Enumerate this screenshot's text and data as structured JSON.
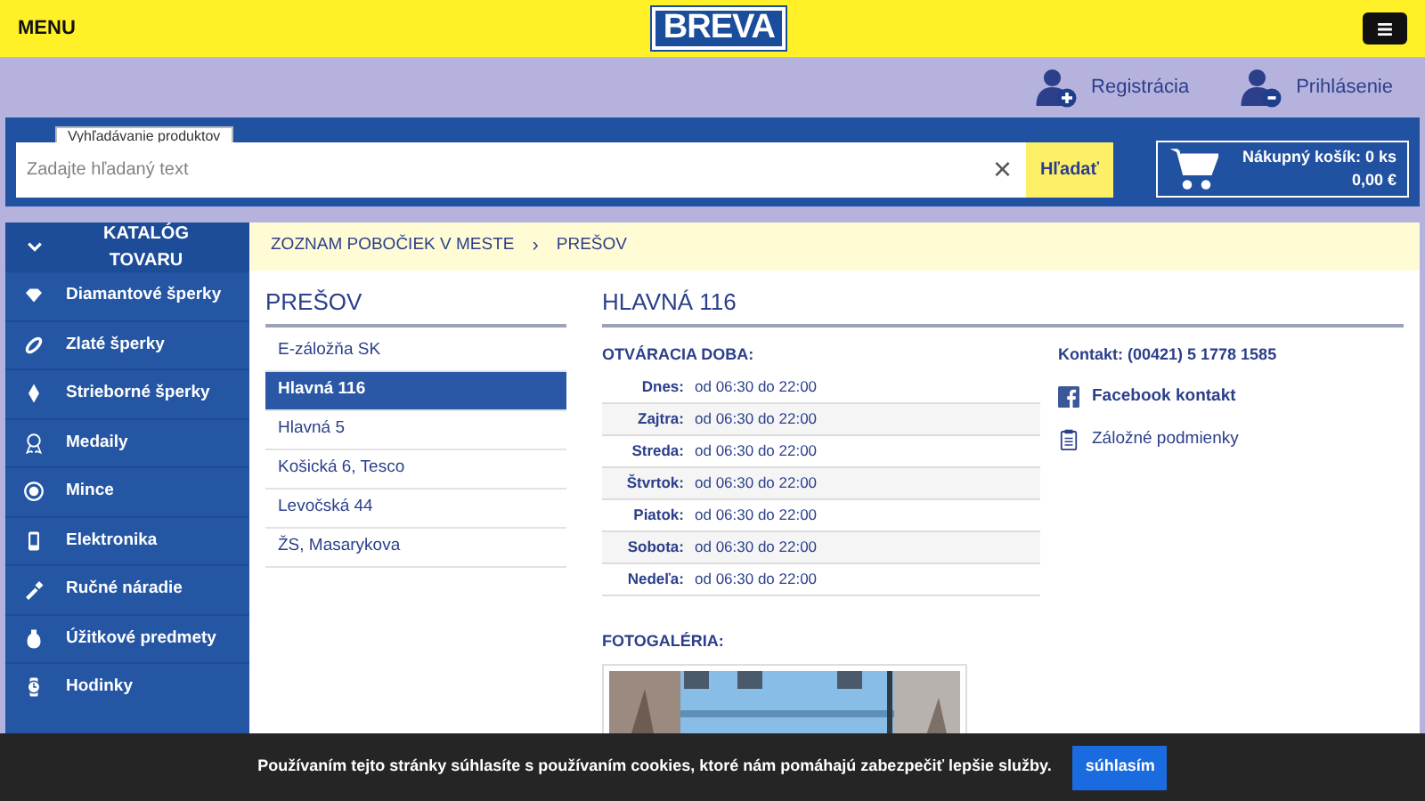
{
  "header": {
    "menu_label": "MENU",
    "logo": "BREVA"
  },
  "account": [
    {
      "label": "Registrácia",
      "kind": "register"
    },
    {
      "label": "Prihlásenie",
      "kind": "login"
    }
  ],
  "search": {
    "legend": "Vyhľadávanie produktov",
    "placeholder": "Zadajte hľadaný text",
    "clear": "×",
    "button": "Hľadať"
  },
  "cart": {
    "title": "Nákupný košík: 0 ks",
    "total": "0,00 €"
  },
  "sidebar": {
    "title": "KATALÓG TOVARU",
    "expanded": true,
    "items": [
      {
        "label": "Diamantové šperky",
        "kind": "diamond"
      },
      {
        "label": "Zlaté šperky",
        "kind": "ring"
      },
      {
        "label": "Strieborné šperky",
        "kind": "gem"
      },
      {
        "label": "Medaily",
        "kind": "medal"
      },
      {
        "label": "Mince",
        "kind": "coin"
      },
      {
        "label": "Elektronika",
        "kind": "phone"
      },
      {
        "label": "Ručné náradie",
        "kind": "tool"
      },
      {
        "label": "Úžitkové predmety",
        "kind": "vase"
      },
      {
        "label": "Hodinky",
        "kind": "watch"
      }
    ]
  },
  "breadcrumb": [
    "ZOZNAM POBOČIEK V MESTE",
    "PREŠOV"
  ],
  "breadcrumb_separator": "›",
  "city": {
    "title": "PREŠOV",
    "branches": [
      {
        "label": "E-záložňa SK",
        "selected": false
      },
      {
        "label": "Hlavná 116",
        "selected": true
      },
      {
        "label": "Hlavná 5",
        "selected": false
      },
      {
        "label": "Košická 6, Tesco",
        "selected": false
      },
      {
        "label": "Levočská 44",
        "selected": false
      },
      {
        "label": "ŽS, Masarykova",
        "selected": false
      }
    ]
  },
  "branch": {
    "title": "HLAVNÁ 116",
    "hours_title": "OTVÁRACIA DOBA:",
    "hours": [
      {
        "day": "Dnes:",
        "time": "od 06:30 do 22:00"
      },
      {
        "day": "Zajtra:",
        "time": "od 06:30 do 22:00"
      },
      {
        "day": "Streda:",
        "time": "od 06:30 do 22:00"
      },
      {
        "day": "Štvrtok:",
        "time": "od 06:30 do 22:00"
      },
      {
        "day": "Piatok:",
        "time": "od 06:30 do 22:00"
      },
      {
        "day": "Sobota:",
        "time": "od 06:30 do 22:00"
      },
      {
        "day": "Nedeľa:",
        "time": "od 06:30 do 22:00"
      }
    ],
    "contact": "Kontakt: (00421) 5 1778 1585",
    "links": [
      {
        "label": "Facebook kontakt",
        "kind": "facebook"
      },
      {
        "label": "Záložné podmienky",
        "kind": "document"
      }
    ],
    "gallery_title": "FOTOGALÉRIA:"
  },
  "cookie_bar": {
    "text": "Používaním tejto stránky súhlasíte s používaním cookies, ktoré nám pomáhajú zabezpečiť lepšie služby.",
    "button": "súhlasím"
  }
}
